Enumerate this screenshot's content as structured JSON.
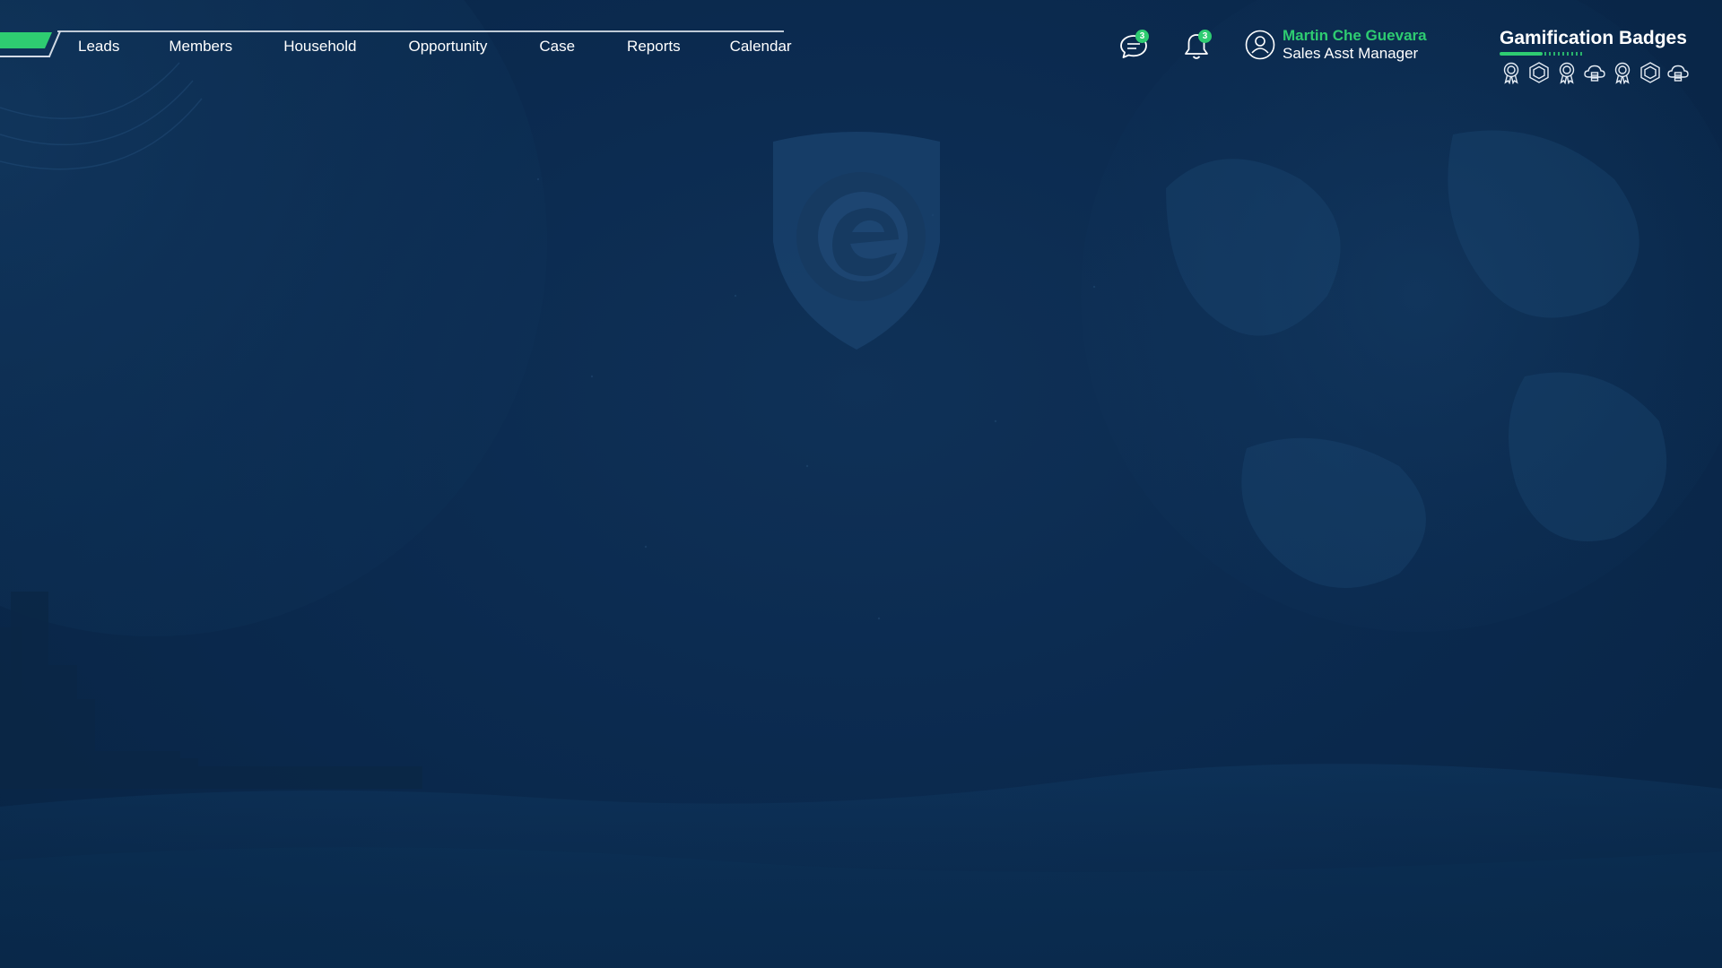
{
  "nav": {
    "items": [
      {
        "label": "Leads",
        "icon": "leads-nav"
      },
      {
        "label": "Members",
        "icon": "members-nav"
      },
      {
        "label": "Household",
        "icon": "household-nav"
      },
      {
        "label": "Opportunity",
        "icon": "opportunity-nav"
      },
      {
        "label": "Case",
        "icon": "case-nav"
      },
      {
        "label": "Reports",
        "icon": "reports-nav"
      },
      {
        "label": "Calendar",
        "icon": "calendar-nav"
      }
    ]
  },
  "header": {
    "messages": {
      "icon": "chat-icon",
      "count": "3"
    },
    "notifications": {
      "icon": "bell-icon",
      "count": "3"
    },
    "user": {
      "icon": "user-avatar-icon",
      "name": "Martin Che Guevara",
      "role": "Sales Asst Manager"
    },
    "gamification": {
      "title": "Gamification Badges",
      "badges": [
        "award-icon",
        "hexagon-icon",
        "award-icon",
        "cloud-badge-icon",
        "award-icon",
        "hexagon-icon",
        "cloud-badge-icon"
      ]
    }
  },
  "colors": {
    "background": "#0b2a4f",
    "accent": "#2ecc71",
    "text": "#ffffff"
  },
  "logo": {
    "icon": "brand-shield-logo",
    "letter": "e"
  }
}
